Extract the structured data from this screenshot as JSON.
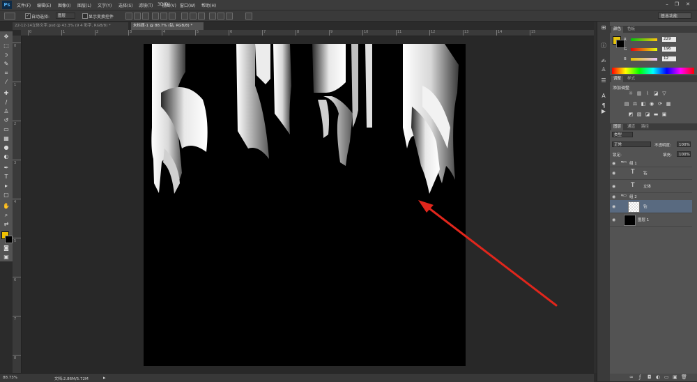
{
  "app": {
    "logo": "Ps",
    "logo_icon": "photoshop-logo"
  },
  "menu": [
    "文件(F)",
    "编辑(E)",
    "图像(I)",
    "图层(L)",
    "文字(Y)",
    "选择(S)",
    "滤镜(T)",
    "3D(D)",
    "视图(V)",
    "窗口(W)",
    "帮助(H)"
  ],
  "options_bar": {
    "auto_select_label": "自动选择:",
    "auto_select_value": "图层",
    "show_transform_label": "显示变换控件",
    "workspace": "基本功能"
  },
  "tabs": [
    {
      "label": "22-12-14立体文字.psd @ 43.3% (9 4 彩字, RGB/8) *",
      "active": false
    },
    {
      "label": "未标题-1 @ 88.7% (钻, RGB/8) *",
      "active": true
    }
  ],
  "ruler": {
    "h_labels": [
      "0",
      "1",
      "2",
      "3",
      "4",
      "5",
      "6",
      "7",
      "8",
      "9",
      "10",
      "11",
      "12",
      "13",
      "14",
      "15"
    ],
    "v_labels": [
      "0",
      "1",
      "2",
      "3",
      "4",
      "5",
      "6",
      "7",
      "8"
    ]
  },
  "status": {
    "zoom": "88.73%",
    "doc": "文档:2.86M/5.72M"
  },
  "color_panel": {
    "tabs": [
      "颜色",
      "色板"
    ],
    "r_label": "R",
    "g_label": "G",
    "b_label": "B",
    "r": "229",
    "g": "196",
    "b": "12",
    "foreground_color": "#e5c40c"
  },
  "adjust_panel": {
    "tabs": [
      "调整",
      "样式"
    ],
    "title": "添加调整"
  },
  "layers_panel": {
    "tabs": [
      "图层",
      "通道",
      "路径"
    ],
    "kind_label": "类型",
    "blend_mode": "正常",
    "opacity_label": "不透明度:",
    "opacity": "100%",
    "lock_label": "锁定:",
    "fill_label": "填充:",
    "fill": "100%",
    "layers": [
      {
        "name": "组 1",
        "type": "group",
        "selected": false
      },
      {
        "name": "钻",
        "type": "text",
        "selected": false
      },
      {
        "name": "立体",
        "type": "text",
        "selected": false
      },
      {
        "name": "组 2",
        "type": "group",
        "selected": false
      },
      {
        "name": "钻",
        "type": "pixel",
        "selected": true
      },
      {
        "name": "图层 1",
        "type": "pixel",
        "selected": false
      }
    ]
  },
  "annotation": {
    "arrow_color": "#e0261c"
  }
}
